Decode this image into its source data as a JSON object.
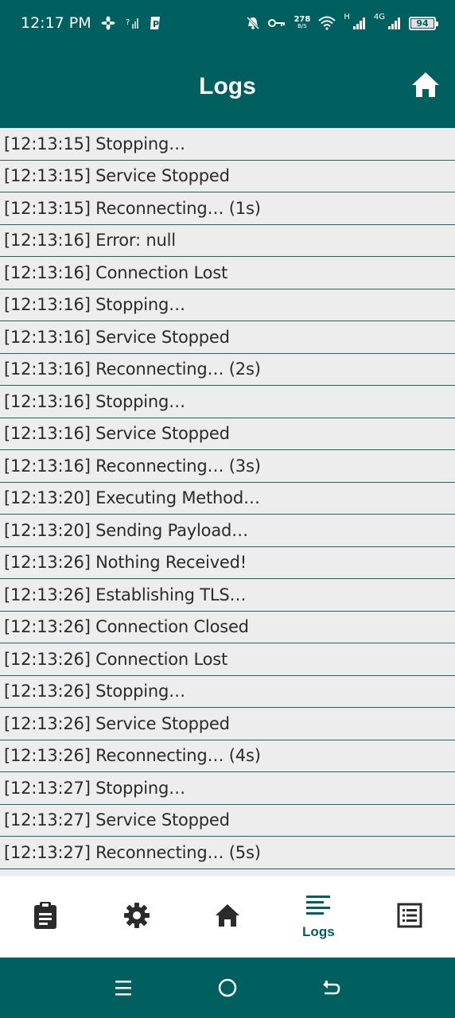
{
  "status_bar": {
    "time": "12:17 PM",
    "speed_value": "278",
    "speed_unit": "B/S",
    "net_h": "H",
    "net_4g": "4G",
    "battery": "94",
    "icons": [
      "fan-icon",
      "signal-question-icon",
      "p-app-icon",
      "mute-icon",
      "key-icon",
      "wifi-icon",
      "signal-icon",
      "signal-icon",
      "battery-icon"
    ]
  },
  "app_bar": {
    "title": "Logs",
    "action_icon": "home-icon"
  },
  "logs": [
    "[12:13:15] Stopping…",
    "[12:13:15] Service Stopped",
    "[12:13:15] Reconnecting… (1s)",
    "[12:13:16] Error: null",
    "[12:13:16] Connection Lost",
    "[12:13:16] Stopping…",
    "[12:13:16] Service Stopped",
    "[12:13:16] Reconnecting… (2s)",
    "[12:13:16] Stopping…",
    "[12:13:16] Service Stopped",
    "[12:13:16] Reconnecting… (3s)",
    "[12:13:20] Executing Method…",
    "[12:13:20] Sending Payload…",
    "[12:13:26] Nothing Received!",
    "[12:13:26] Establishing TLS…",
    "[12:13:26] Connection Closed",
    "[12:13:26] Connection Lost",
    "[12:13:26] Stopping…",
    "[12:13:26] Service Stopped",
    "[12:13:26] Reconnecting… (4s)",
    "[12:13:27] Stopping…",
    "[12:13:27] Service Stopped",
    "[12:13:27] Reconnecting… (5s)"
  ],
  "bottom_nav": {
    "items": [
      {
        "icon": "clipboard-icon",
        "label": ""
      },
      {
        "icon": "gear-icon",
        "label": ""
      },
      {
        "icon": "home-icon",
        "label": ""
      },
      {
        "icon": "logs-icon",
        "label": "Logs",
        "selected": true
      },
      {
        "icon": "list-icon",
        "label": ""
      }
    ]
  },
  "system_nav": [
    "menu-icon",
    "home-circle-icon",
    "back-icon"
  ],
  "colors": {
    "primary": "#006060",
    "row_bg": "#ededed",
    "divider": "#1f6464",
    "text": "#2a2a2a"
  }
}
